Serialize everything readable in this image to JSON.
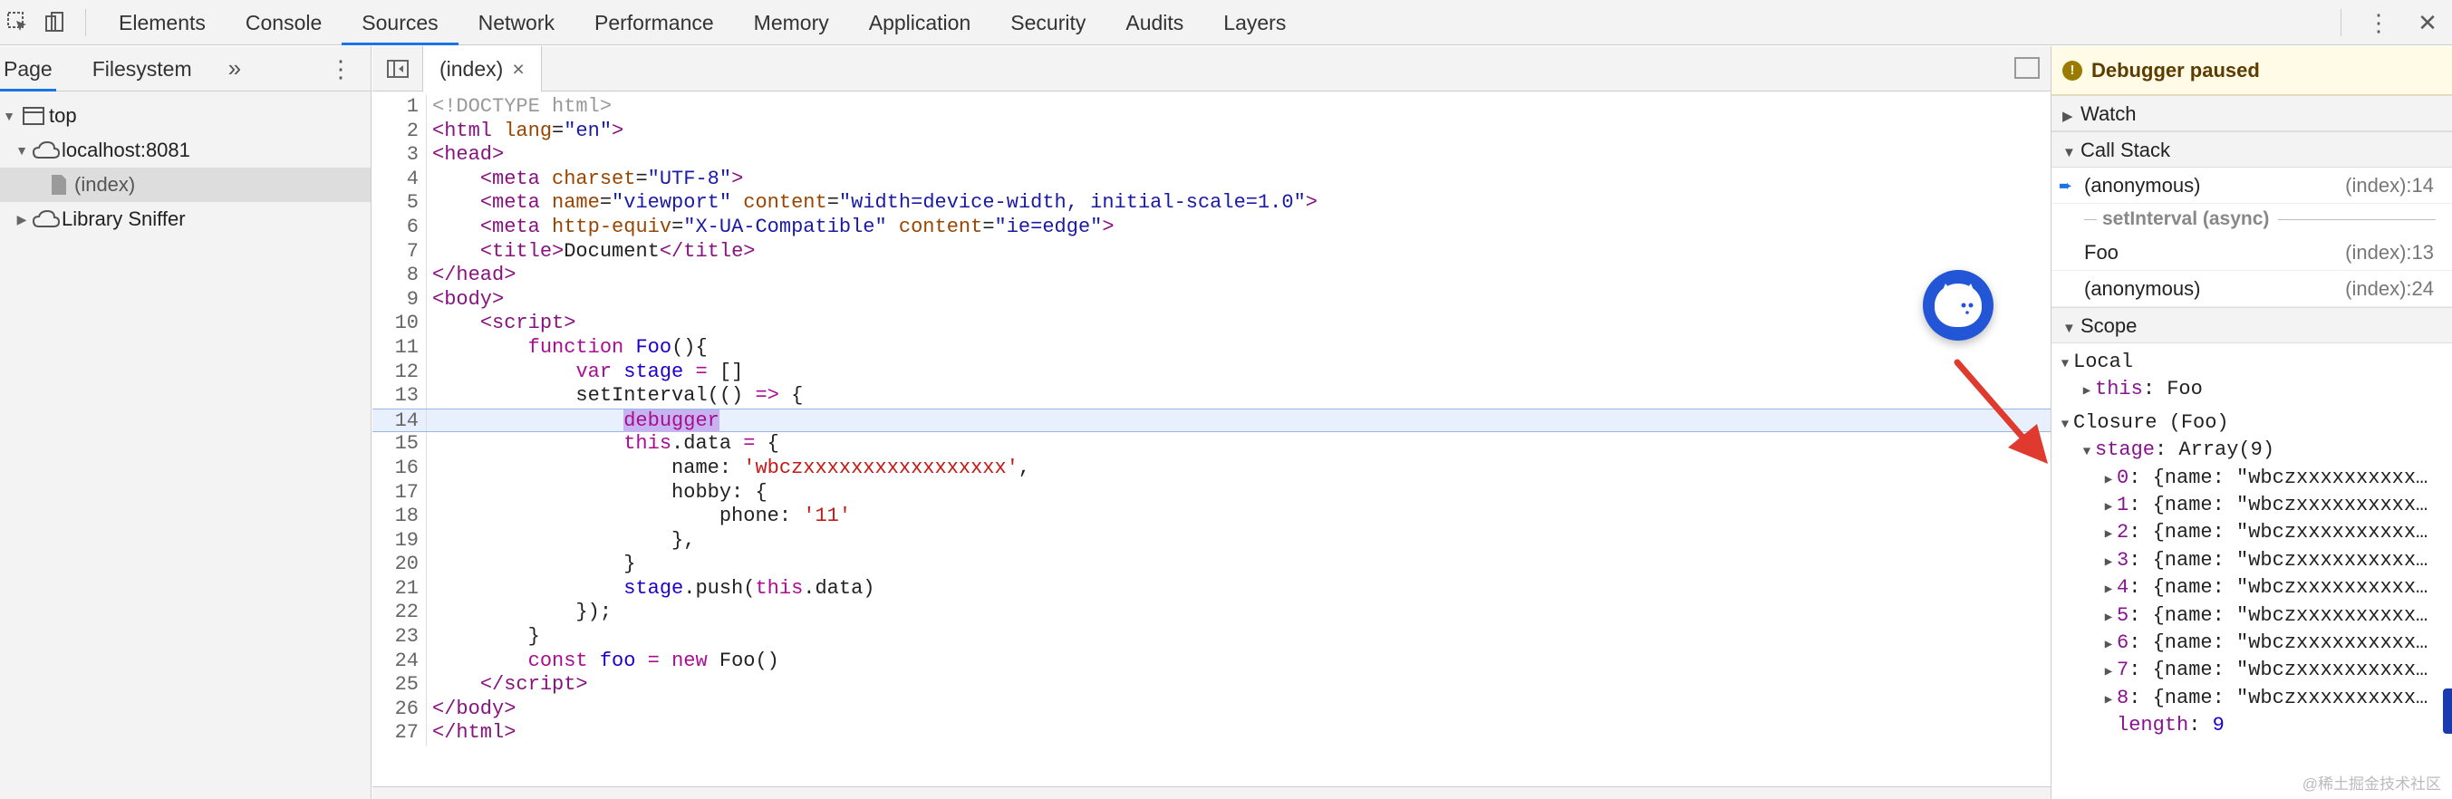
{
  "topbar": {
    "tabs": [
      "Elements",
      "Console",
      "Sources",
      "Network",
      "Performance",
      "Memory",
      "Application",
      "Security",
      "Audits",
      "Layers"
    ],
    "active_tab": "Sources"
  },
  "navigator": {
    "tabs": [
      "Page",
      "Filesystem"
    ],
    "more": "»",
    "tree": [
      {
        "label": "top",
        "icon": "frame-icon",
        "level": 0,
        "expanded": true
      },
      {
        "label": "localhost:8081",
        "icon": "cloud-icon",
        "level": 1,
        "expanded": true
      },
      {
        "label": "(index)",
        "icon": "file-icon",
        "level": 2,
        "selected": true
      },
      {
        "label": "Library Sniffer",
        "icon": "cloud-icon",
        "level": 1,
        "expanded": false
      }
    ]
  },
  "editor": {
    "tab_label": "(index)",
    "close": "×",
    "current_line": 14
  },
  "debugger": {
    "paused": "Debugger paused",
    "watch": "Watch",
    "call_stack": "Call Stack",
    "frames": [
      {
        "name": "(anonymous)",
        "loc": "(index):14",
        "active": true
      },
      {
        "name": "Foo",
        "loc": "(index):13"
      },
      {
        "name": "(anonymous)",
        "loc": "(index):24"
      }
    ],
    "async_label": "setInterval (async)",
    "scope": "Scope",
    "local": "Local",
    "this_key": "this",
    "this_val": "Foo",
    "closure": "Closure (Foo)",
    "stage_key": "stage",
    "stage_val": "Array(9)",
    "item_text": "{name: \"wbczxxxxxxxxxx…",
    "length_key": "length",
    "length_val": "9"
  },
  "watermark": "@稀土掘金技术社区"
}
